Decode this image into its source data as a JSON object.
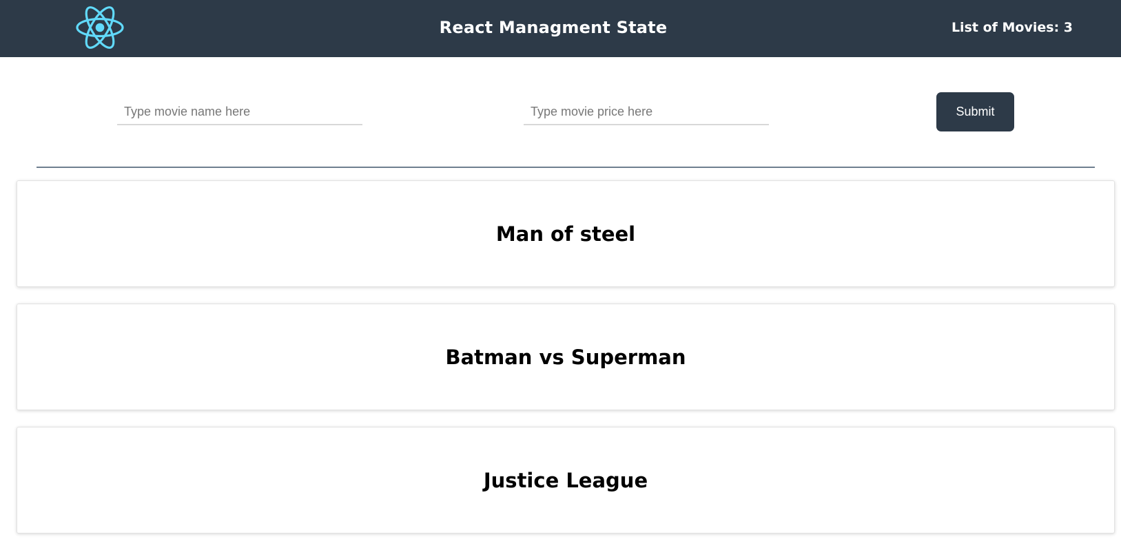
{
  "navbar": {
    "logo_icon": "react-atom-icon",
    "title": "React Managment State",
    "movie_count_text": "List of Movies: 3"
  },
  "form": {
    "name_placeholder": "Type movie name here",
    "name_value": "",
    "price_placeholder": "Type movie price here",
    "price_value": "",
    "submit_label": "Submit"
  },
  "movies": [
    {
      "title": "Man of steel"
    },
    {
      "title": "Batman vs Superman"
    },
    {
      "title": "Justice League"
    }
  ],
  "colors": {
    "navbar_bg": "#2d3a48",
    "react_blue": "#61dafb",
    "button_bg": "#2d3a48",
    "divider": "#6e7f8f"
  }
}
